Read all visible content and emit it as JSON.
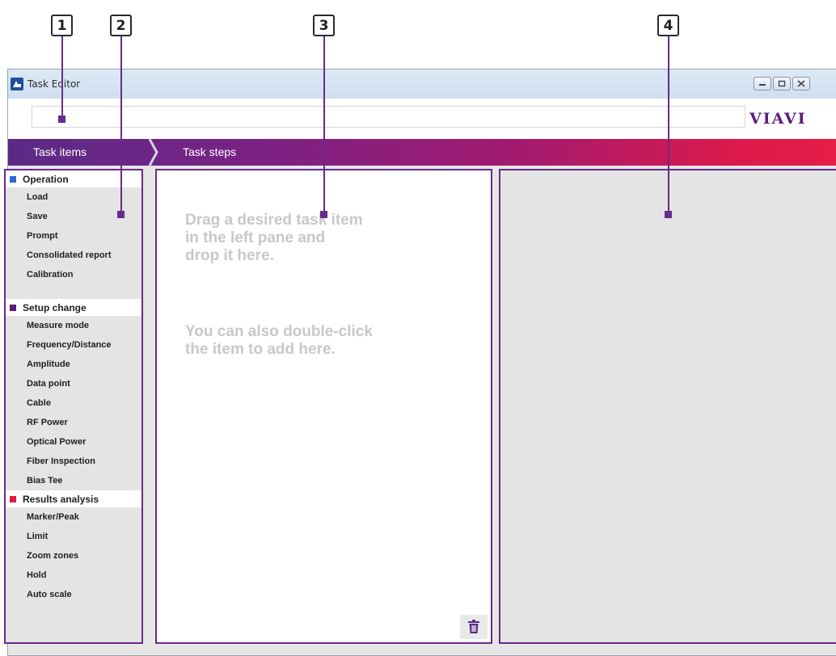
{
  "callouts": [
    "1",
    "2",
    "3",
    "4"
  ],
  "window": {
    "title": "Task Editor",
    "logo": "VIAVI",
    "task_name": {
      "value": "",
      "placeholder": ""
    }
  },
  "nav": {
    "task_items": "Task items",
    "task_steps": "Task steps"
  },
  "categories": [
    {
      "label": "Operation",
      "color": "#2e6bd0",
      "items": [
        "Load",
        "Save",
        "Prompt",
        "Consolidated report",
        "Calibration"
      ]
    },
    {
      "label": "Setup change",
      "color": "#5a1b82",
      "items": [
        "Measure mode",
        "Frequency/Distance",
        "Amplitude",
        "Data point",
        "Cable",
        "RF Power",
        "Optical Power",
        "Fiber Inspection",
        "Bias Tee"
      ]
    },
    {
      "label": "Results analysis",
      "color": "#e2193f",
      "items": [
        "Marker/Peak",
        "Limit",
        "Zoom zones",
        "Hold",
        "Auto scale"
      ]
    }
  ],
  "steps_pane": {
    "hint1": "Drag a desired task item\nin the left pane and\ndrop it here.",
    "hint2": "You can also double-click\nthe item to add here.",
    "delete_icon": "trash-icon"
  }
}
